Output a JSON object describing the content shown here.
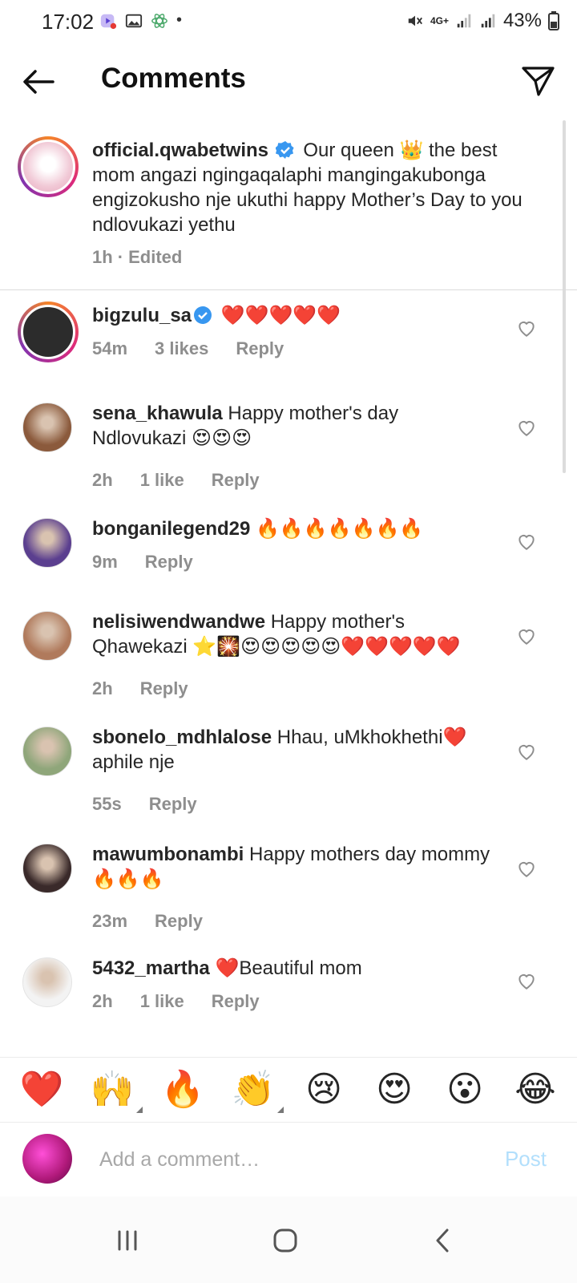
{
  "status_bar": {
    "time": "17:02",
    "network": "4G+",
    "battery": "43%"
  },
  "header": {
    "title": "Comments"
  },
  "caption": {
    "username": "official.qwabetwins",
    "text": "Our queen 👑 the best mom angazi ngingaqalaphi mangingakubonga engizokusho nje ukuthi happy Mother’s Day to you ndlovukazi yethu",
    "time": "1h",
    "edited": "· Edited",
    "avatar_color": "#f1c9d6"
  },
  "comments": [
    {
      "username": "bigzulu_sa",
      "verified": true,
      "text": "❤️❤️❤️❤️❤️",
      "time": "54m",
      "likes": "3 likes",
      "reply": "Reply",
      "avatar_color": "#2c2c2c"
    },
    {
      "username": "sena_khawula",
      "verified": false,
      "text": "Happy mother's day Ndlovukazi 😍😍😍",
      "time": "2h",
      "likes": "1 like",
      "reply": "Reply",
      "avatar_color": "#8b5a3c"
    },
    {
      "username": "bonganilegend29",
      "verified": false,
      "text": "🔥🔥🔥🔥🔥🔥🔥",
      "time": "9m",
      "likes": "",
      "reply": "Reply",
      "avatar_color": "#5b3f8f"
    },
    {
      "username": "nelisiwendwandwe",
      "verified": false,
      "text": "Happy mother's Qhawekazi ⭐🎇😍😍😍😍😍❤️❤️❤️❤️❤️",
      "time": "2h",
      "likes": "",
      "reply": "Reply",
      "avatar_color": "#b07a5c"
    },
    {
      "username": "sbonelo_mdhlalose",
      "verified": false,
      "text": "Hhau, uMkhokhethi❤️ aphile nje",
      "time": "55s",
      "likes": "",
      "reply": "Reply",
      "avatar_color": "#8fa67a"
    },
    {
      "username": "mawumbonambi",
      "verified": false,
      "text": "Happy mothers day mommy🔥🔥🔥",
      "time": "23m",
      "likes": "",
      "reply": "Reply",
      "avatar_color": "#3a2a2a"
    },
    {
      "username": "5432_martha",
      "verified": false,
      "text": "❤️Beautiful mom",
      "time": "2h",
      "likes": "1 like",
      "reply": "Reply",
      "avatar_color": "#f3f3f3"
    }
  ],
  "emoji_bar": [
    "❤️",
    "🙌",
    "🔥",
    "👏",
    "😢",
    "😍",
    "😮",
    "😂"
  ],
  "input": {
    "placeholder": "Add a comment…",
    "post_label": "Post"
  },
  "colors": {
    "link": "#0095f6",
    "post_disabled": "#b2dffc",
    "verified": "#3897f0",
    "meta": "#8e8e8e"
  }
}
